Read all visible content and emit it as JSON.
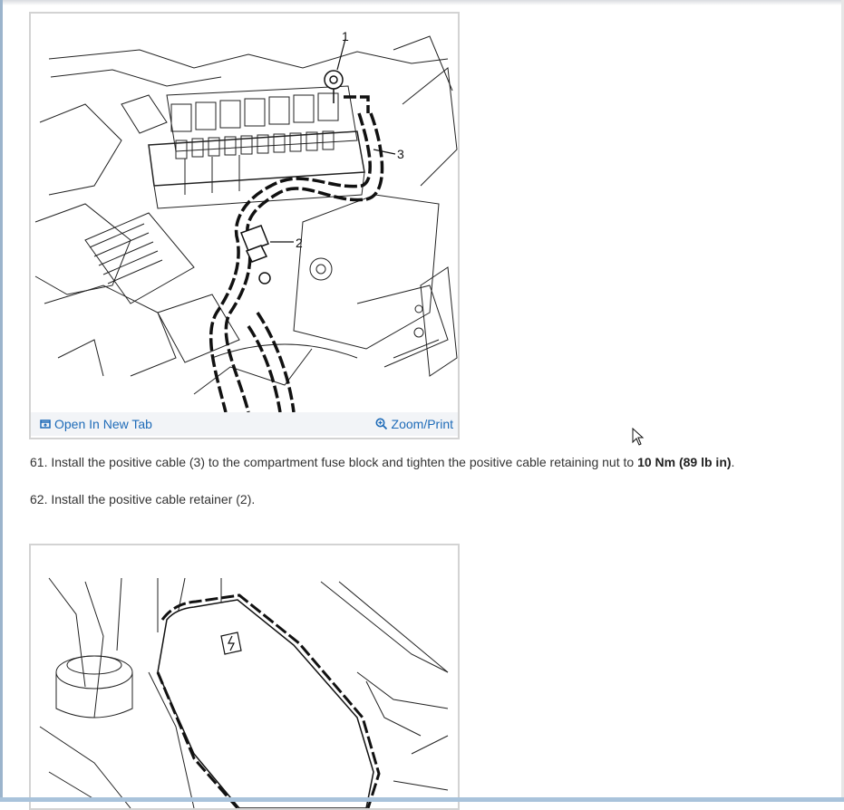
{
  "figure1": {
    "callouts": [
      "1",
      "2",
      "3"
    ],
    "open_label": "Open In New Tab",
    "zoom_label": "Zoom/Print"
  },
  "steps": [
    {
      "text": "61. Install the positive cable (3) to the compartment fuse block and tighten the positive cable retaining nut to ",
      "bold": "10 Nm (89 lb in)",
      "suffix": "."
    },
    {
      "text": "62. Install the positive cable retainer (2).",
      "bold": "",
      "suffix": ""
    }
  ],
  "icons": {
    "open": "open-new-tab-icon",
    "zoom": "zoom-icon",
    "cursor": "mouse-cursor-icon"
  },
  "colors": {
    "link": "#1e6bb8",
    "text": "#333333",
    "card_border": "#d3d3d3"
  }
}
